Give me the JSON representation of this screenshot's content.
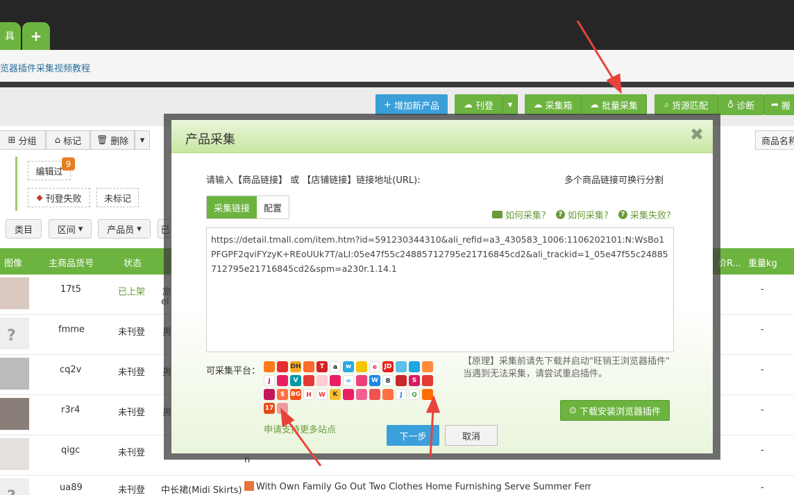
{
  "tabs": {
    "first": "具",
    "plus": "+"
  },
  "linkbar": {
    "text": "览器插件采集视频教程"
  },
  "toolbar": {
    "add_product": "增加新产品",
    "publish": "刊登",
    "collect_box": "采集箱",
    "batch_collect": "批量采集",
    "source_match": "货源匹配",
    "diagnose": "诊断",
    "move": "搬",
    "product_name": "商品名称"
  },
  "actions": {
    "group": "分组",
    "mark": "标记",
    "delete": "删除"
  },
  "filters": {
    "edited": "编辑过",
    "edited_count": "9",
    "publish_failed": "刊登失败",
    "unmarked": "未标记",
    "category": "类目",
    "range": "区间",
    "product_staff": "产品员",
    "cut": "已"
  },
  "table": {
    "headers": {
      "image": "图像",
      "sku": "主商品货号",
      "status": "状态",
      "price_r": "价R...",
      "weight": "重量kg"
    },
    "rows": [
      {
        "sku": "17t5",
        "status": "已上架",
        "cat": "旅",
        "extra": "el",
        "w": "-"
      },
      {
        "sku": "fmme",
        "status": "未刊登",
        "cat": "男",
        "w": "-"
      },
      {
        "sku": "cq2v",
        "status": "未刊登",
        "cat": "男",
        "w": "-"
      },
      {
        "sku": "r3r4",
        "status": "未刊登",
        "cat": "男",
        "w": "-"
      },
      {
        "sku": "qigc",
        "status": "未刊登",
        "cat": "",
        "extra": "n",
        "w": "-"
      },
      {
        "sku": "ua89",
        "status": "未刊登",
        "cat": "中长裙(Midi Skirts)",
        "title": "With Own Family Go Out Two Clothes Home Furnishing Serve Summer Fema",
        "w": "-"
      }
    ]
  },
  "modal": {
    "title": "产品采集",
    "close": "✖",
    "prompt": "请输入【商品链接】 或 【店铺链接】链接地址(URL):",
    "hint_right": "多个商品链接可换行分割",
    "tab_collect": "采集链接",
    "tab_config": "配置",
    "help_video": "如何采集?",
    "help_how": "如何采集?",
    "help_fail": "采集失败?",
    "url_text": "https://detail.tmall.com/item.htm?id=591230344310&ali_refid=a3_430583_1006:1106202101:N:WsBo1PFGPF2qviFYzyK+REoUUk7T/aLI:05e47f55c24885712795e21716845cd2&ali_trackid=1_05e47f55c24885712795e21716845cd2&spm=a230r.1.14.1",
    "platforms_label": "可采集平台：",
    "note_line1": "【原理】采集前请先下载并启动\"旺销王浏览器插件\"",
    "note_line2": "当遇到无法采集，请尝试重启插件。",
    "download_btn": "下载安装浏览器插件",
    "apply_link": "申请支持更多站点",
    "next_btn": "下一步",
    "cancel_btn": "取消"
  },
  "colors": {
    "green": "#6cb33f",
    "blue": "#3b9fd9",
    "dark": "#262626",
    "arrow": "#e8433a"
  }
}
